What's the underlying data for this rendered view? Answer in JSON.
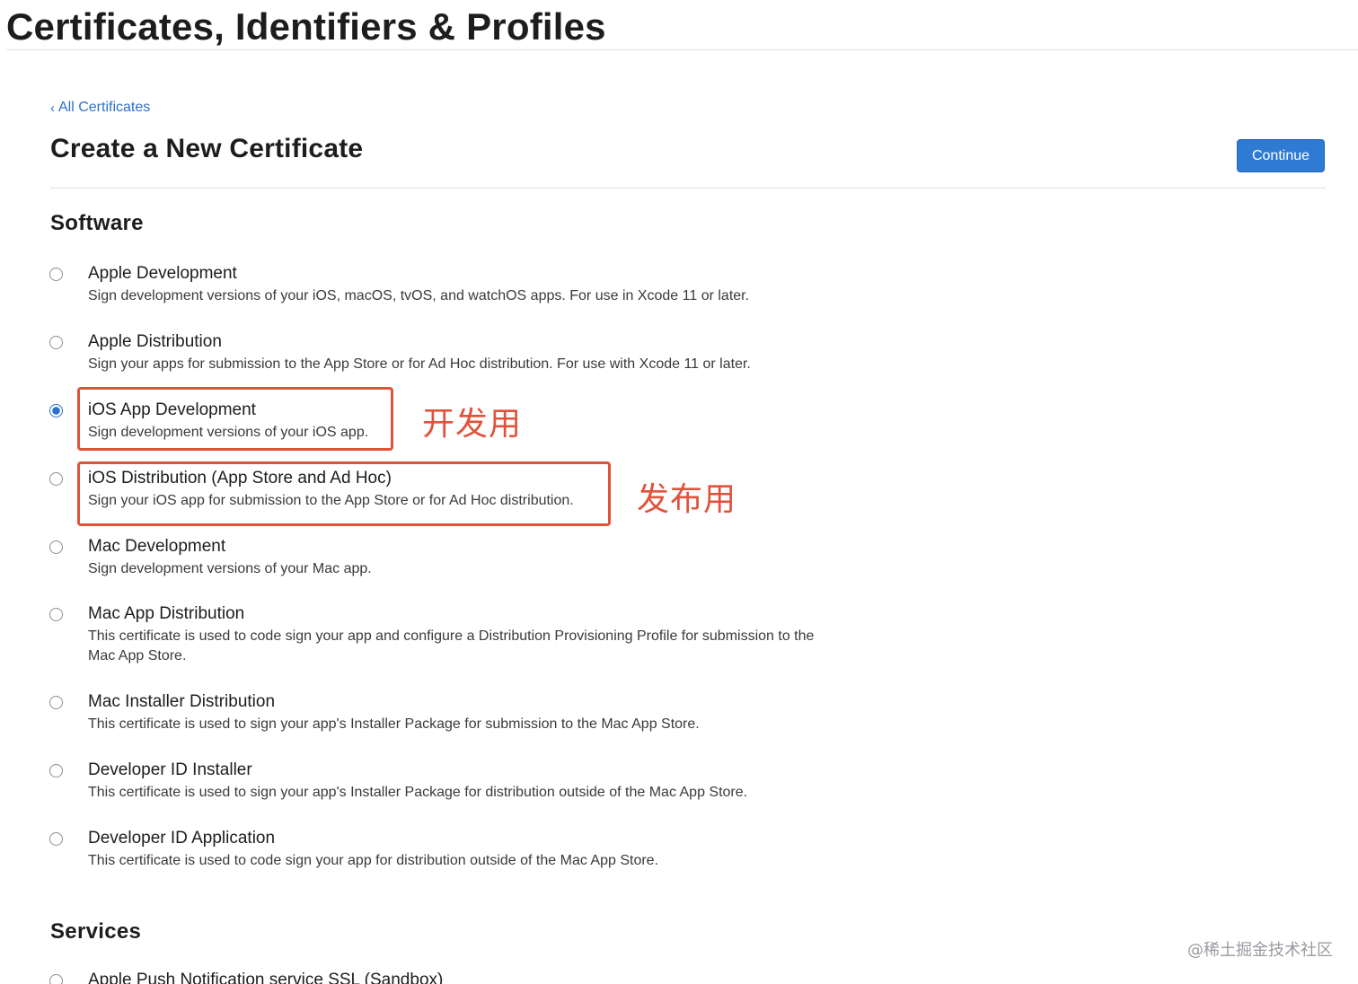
{
  "app_title": "Certificates, Identifiers & Profiles",
  "breadcrumb": {
    "back_label": "All Certificates",
    "chevron": "‹"
  },
  "page_heading": "Create a New Certificate",
  "continue_label": "Continue",
  "colors": {
    "accent": "#2f7bd4",
    "link": "#2d6fcf",
    "highlight": "#e0533b"
  },
  "sections": {
    "software": {
      "title": "Software",
      "options": [
        {
          "title": "Apple Development",
          "description": "Sign development versions of your iOS, macOS, tvOS, and watchOS apps. For use in Xcode 11 or later.",
          "selected": false
        },
        {
          "title": "Apple Distribution",
          "description": "Sign your apps for submission to the App Store or for Ad Hoc distribution. For use with Xcode 11 or later.",
          "selected": false
        },
        {
          "title": "iOS App Development",
          "description": "Sign development versions of your iOS app.",
          "selected": true
        },
        {
          "title": "iOS Distribution (App Store and Ad Hoc)",
          "description": "Sign your iOS app for submission to the App Store or for Ad Hoc distribution.",
          "selected": false
        },
        {
          "title": "Mac Development",
          "description": "Sign development versions of your Mac app.",
          "selected": false
        },
        {
          "title": "Mac App Distribution",
          "description": "This certificate is used to code sign your app and configure a Distribution Provisioning Profile for submission to the Mac App Store.",
          "selected": false
        },
        {
          "title": "Mac Installer Distribution",
          "description": "This certificate is used to sign your app's Installer Package for submission to the Mac App Store.",
          "selected": false
        },
        {
          "title": "Developer ID Installer",
          "description": "This certificate is used to sign your app's Installer Package for distribution outside of the Mac App Store.",
          "selected": false
        },
        {
          "title": "Developer ID Application",
          "description": "This certificate is used to code sign your app for distribution outside of the Mac App Store.",
          "selected": false
        }
      ]
    },
    "services": {
      "title": "Services",
      "options": [
        {
          "title": "Apple Push Notification service SSL (Sandbox)",
          "selected": false
        }
      ]
    }
  },
  "annotations": {
    "development_note": "开发用",
    "distribution_note": "发布用"
  },
  "watermark": "@稀土掘金技术社区"
}
